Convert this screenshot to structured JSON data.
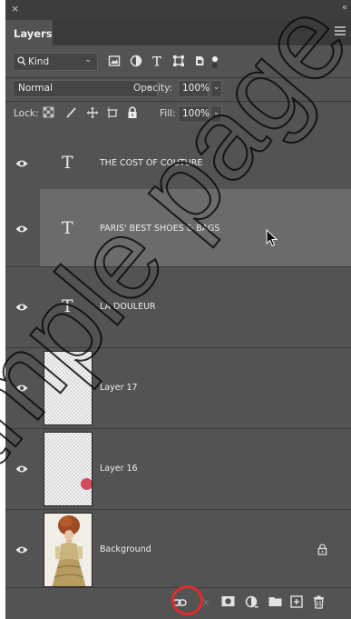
{
  "panel": {
    "close_glyph": "×",
    "collapse_glyph": "«",
    "tab_label": "Layers"
  },
  "filter": {
    "kind_label": "Kind",
    "kind_icon": "search-icon",
    "filter_icons": [
      "pixel-filter-icon",
      "adjustment-filter-icon",
      "type-filter-icon",
      "shape-filter-icon",
      "smart-object-filter-icon"
    ]
  },
  "blend": {
    "mode": "Normal",
    "opacity_label": "Opacity:",
    "opacity_value": "100%"
  },
  "lock": {
    "label": "Lock:",
    "icons": [
      "lock-transparent-icon",
      "lock-paint-icon",
      "lock-position-icon",
      "lock-artboard-icon",
      "lock-all-icon"
    ],
    "fill_label": "Fill:",
    "fill_value": "100%"
  },
  "layers": [
    {
      "name": "THE COST OF COUTURE",
      "kind": "type",
      "type_glyph": "T",
      "visible": true,
      "selected": false
    },
    {
      "name": "PARIS' BEST SHOES  & BAGS",
      "kind": "type",
      "type_glyph": "T",
      "visible": true,
      "selected": true
    },
    {
      "name": "LA DOULEUR",
      "kind": "type",
      "type_glyph": "T",
      "visible": true,
      "selected": false
    },
    {
      "name": "Layer 17",
      "kind": "pixel",
      "visible": true,
      "selected": false
    },
    {
      "name": "Layer 16",
      "kind": "pixel",
      "visible": true,
      "selected": false
    },
    {
      "name": "Background",
      "kind": "background",
      "visible": true,
      "selected": false,
      "locked": true
    }
  ],
  "bottom_bar": {
    "icons": [
      "link-layers-icon",
      "fx-icon",
      "add-mask-icon",
      "adjustment-layer-icon",
      "new-group-icon",
      "new-layer-icon",
      "delete-layer-icon"
    ],
    "fx_label": "fx"
  },
  "watermark": {
    "text": "sample page"
  },
  "colors": {
    "panel_bg": "#535353",
    "selected_row": "#6b6b6b",
    "highlight": "#e22b2b",
    "red_dot": "#d44d5c"
  }
}
